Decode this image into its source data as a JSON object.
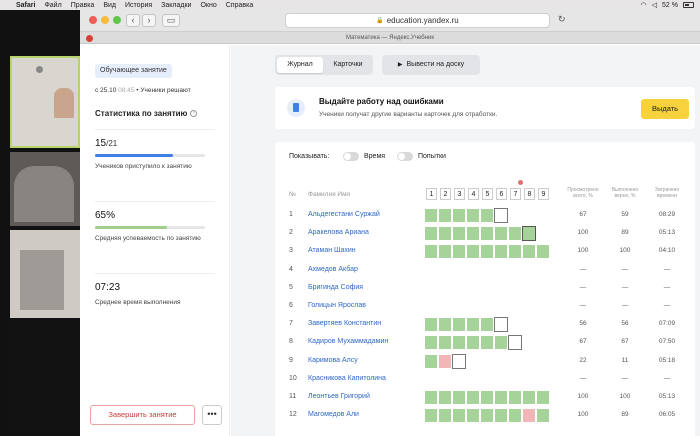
{
  "menubar": {
    "items": [
      "Safari",
      "Файл",
      "Правка",
      "Вид",
      "История",
      "Закладки",
      "Окно",
      "Справка"
    ],
    "battery": "52 %"
  },
  "browser": {
    "url": "education.yandex.ru",
    "tab_title": "Математика — Яндекс.Учебник",
    "nav_back": "‹",
    "nav_forward": "›",
    "reload": "↻"
  },
  "sidebar": {
    "badge": "Обучающее занятие",
    "since_prefix": "с 25.10",
    "since_time": "08:45",
    "since_suffix": "• Ученики решают",
    "stats_title": "Статистика по занятию",
    "stat_started": {
      "value": "15",
      "total": "/21",
      "label": "Учеников приступило к занятию",
      "progress": 0.71,
      "color": "#3f7fe8"
    },
    "stat_success": {
      "value": "65%",
      "label": "Средняя успеваемость по занятию",
      "progress": 0.65,
      "color": "#9fce8d"
    },
    "stat_time": {
      "value": "07:23",
      "label": "Среднее время выполнения"
    },
    "finish_button": "Завершить занятие",
    "more_button": "•••"
  },
  "toolbar": {
    "tab_journal": "Журнал",
    "tab_cards": "Карточки",
    "board_button": "Вывести на доску",
    "board_icon": "▶"
  },
  "banner": {
    "title": "Выдайте работу над ошибками",
    "subtitle": "Ученики получат другие варианты карточек для отработки.",
    "button": "Выдать"
  },
  "journal": {
    "show_label": "Показывать:",
    "toggle_time": "Время",
    "toggle_attempts": "Попытки",
    "col_num": "№",
    "col_name": "Фамилия Имя",
    "questions": [
      "1",
      "2",
      "3",
      "4",
      "5",
      "6",
      "7",
      "8",
      "9"
    ],
    "col_viewed": "Просмотрено всего, %",
    "col_correct": "Выполнено верно, %",
    "col_time": "Затрачено времени",
    "rows": [
      {
        "n": "1",
        "name": "Альдегестани Суржай",
        "cells": [
          "g",
          "g",
          "g",
          "g",
          "g",
          "o",
          "e",
          "e",
          "e"
        ],
        "viewed": "67",
        "correct": "59",
        "time": "08:29"
      },
      {
        "n": "2",
        "name": "Аракелова Ариана",
        "cells": [
          "g",
          "g",
          "g",
          "g",
          "g",
          "g",
          "g",
          "go",
          "e"
        ],
        "viewed": "100",
        "correct": "89",
        "time": "05:13"
      },
      {
        "n": "3",
        "name": "Атаман Шахин",
        "cells": [
          "g",
          "g",
          "g",
          "g",
          "g",
          "g",
          "g",
          "g",
          "g"
        ],
        "viewed": "100",
        "correct": "100",
        "time": "04:10"
      },
      {
        "n": "4",
        "name": "Ахмедов Акбар",
        "cells": [
          "e",
          "e",
          "e",
          "e",
          "e",
          "e",
          "e",
          "e",
          "e"
        ],
        "viewed": "—",
        "correct": "—",
        "time": "—"
      },
      {
        "n": "5",
        "name": "Бригинда София",
        "cells": [
          "e",
          "e",
          "e",
          "e",
          "e",
          "e",
          "e",
          "e",
          "e"
        ],
        "viewed": "—",
        "correct": "—",
        "time": "—"
      },
      {
        "n": "6",
        "name": "Голицын Ярослав",
        "cells": [
          "e",
          "e",
          "e",
          "e",
          "e",
          "e",
          "e",
          "e",
          "e"
        ],
        "viewed": "—",
        "correct": "—",
        "time": "—"
      },
      {
        "n": "7",
        "name": "Завертяев Константин",
        "cells": [
          "g",
          "g",
          "g",
          "g",
          "g",
          "o",
          "e",
          "e",
          "e"
        ],
        "viewed": "56",
        "correct": "56",
        "time": "07:09"
      },
      {
        "n": "8",
        "name": "Кадиров Мухаммадамин",
        "cells": [
          "g",
          "g",
          "g",
          "g",
          "g",
          "g",
          "o",
          "e",
          "e"
        ],
        "viewed": "67",
        "correct": "67",
        "time": "07:50"
      },
      {
        "n": "9",
        "name": "Каримова Алсу",
        "cells": [
          "g",
          "p",
          "o",
          "e",
          "e",
          "e",
          "e",
          "e",
          "e"
        ],
        "viewed": "22",
        "correct": "11",
        "time": "05:18"
      },
      {
        "n": "10",
        "name": "Красникова Капитолина",
        "cells": [
          "e",
          "e",
          "e",
          "e",
          "e",
          "e",
          "e",
          "e",
          "e"
        ],
        "viewed": "—",
        "correct": "—",
        "time": "—"
      },
      {
        "n": "11",
        "name": "Леонтьев Григорий",
        "cells": [
          "g",
          "g",
          "g",
          "g",
          "g",
          "g",
          "g",
          "g",
          "g"
        ],
        "viewed": "100",
        "correct": "100",
        "time": "05:13"
      },
      {
        "n": "12",
        "name": "Магомедов Али",
        "cells": [
          "g",
          "g",
          "g",
          "g",
          "g",
          "g",
          "g",
          "p",
          "g"
        ],
        "viewed": "100",
        "correct": "89",
        "time": "06:05"
      }
    ]
  }
}
